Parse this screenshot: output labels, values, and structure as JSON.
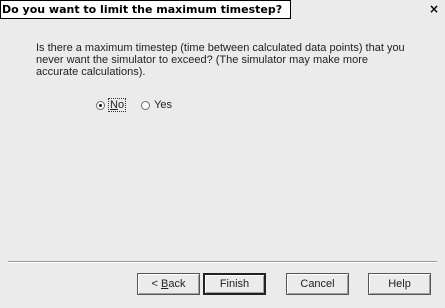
{
  "window": {
    "title": "Do you want to limit the maximum timestep?",
    "close_glyph": "×"
  },
  "prompt": {
    "text": "Is there a maximum timestep (time between calculated data points) that you never want the simulator to exceed? (The simulator may make more accurate calculations)."
  },
  "options": {
    "no_label": "No",
    "yes_label": "Yes",
    "selected": "No"
  },
  "buttons": {
    "back_prefix": "< ",
    "back_mnemonic": "B",
    "back_rest": "ack",
    "finish_label": "Finish",
    "cancel_label": "Cancel",
    "help_label": "Help"
  },
  "icons": {
    "close": "close-icon",
    "radio": "radio-button-icon"
  },
  "colors": {
    "dialog_background": "#ebebeb",
    "title_background": "#ffffff",
    "text": "#222222"
  }
}
